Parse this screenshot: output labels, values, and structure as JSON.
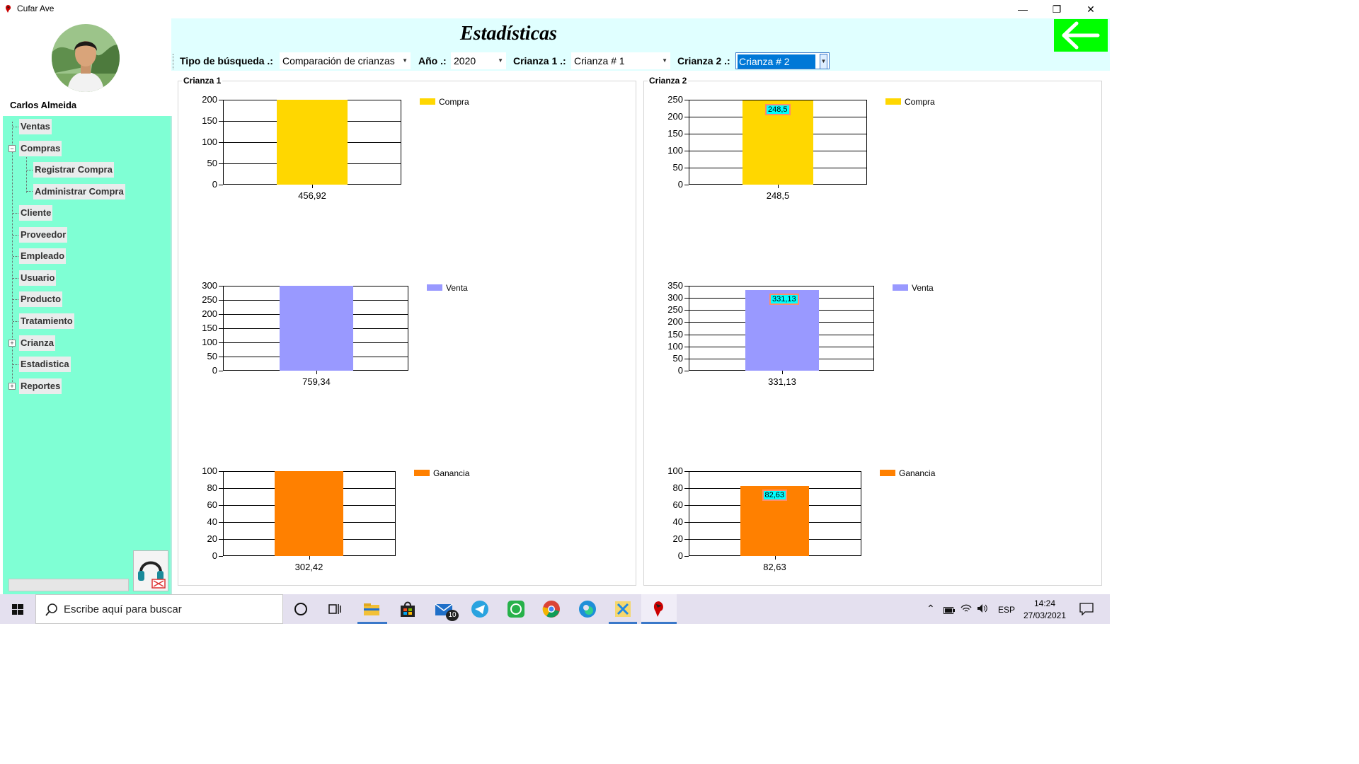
{
  "window": {
    "title": "Cufar Ave",
    "minimize_glyph": "—",
    "restore_glyph": "❐",
    "close_glyph": "✕"
  },
  "user": {
    "name": "Carlos Almeida"
  },
  "menu": {
    "items": [
      {
        "label": "Ventas"
      },
      {
        "label": "Compras",
        "expander": "−"
      },
      {
        "label": "Registrar Compra"
      },
      {
        "label": "Administrar Compra"
      },
      {
        "label": "Cliente"
      },
      {
        "label": "Proveedor"
      },
      {
        "label": "Empleado"
      },
      {
        "label": "Usuario"
      },
      {
        "label": "Producto"
      },
      {
        "label": "Tratamiento"
      },
      {
        "label": "Crianza",
        "expander": "+"
      },
      {
        "label": "Estadistica"
      },
      {
        "label": "Reportes",
        "expander": "+"
      }
    ]
  },
  "header": {
    "title": "Estadísticas",
    "back_icon": "arrow-left-icon",
    "filters": {
      "tipo_label": "Tipo de búsqueda .:",
      "tipo_value": "Comparación de crianzas",
      "anio_label": "Año .:",
      "anio_value": "2020",
      "crianza1_label": "Crianza 1 .:",
      "crianza1_value": "Crianza # 1",
      "crianza2_label": "Crianza 2 .:",
      "crianza2_value": "Crianza # 2"
    }
  },
  "groups": {
    "left_title": "Crianza 1",
    "right_title": "Crianza 2"
  },
  "colors": {
    "compra": "#ffd700",
    "venta": "#9999ff",
    "ganancia": "#ff8000",
    "menu_bg": "#7fffd4",
    "header_bg": "#e0ffff",
    "back_btn": "#00ff00"
  },
  "chart_data": [
    {
      "type": "bar",
      "group": "Crianza 1",
      "series": [
        {
          "name": "Compra",
          "values": [
            200
          ]
        }
      ],
      "categories": [
        "456,92"
      ],
      "ylim": [
        0,
        200
      ],
      "yticks": [
        "200",
        "150",
        "100",
        "50",
        "0"
      ],
      "legend": "top-right",
      "grid": true
    },
    {
      "type": "bar",
      "group": "Crianza 1",
      "series": [
        {
          "name": "Venta",
          "values": [
            300
          ]
        }
      ],
      "categories": [
        "759,34"
      ],
      "ylim": [
        0,
        300
      ],
      "yticks": [
        "300",
        "250",
        "200",
        "150",
        "100",
        "50",
        "0"
      ],
      "legend": "top-right",
      "grid": true
    },
    {
      "type": "bar",
      "group": "Crianza 1",
      "series": [
        {
          "name": "Ganancia",
          "values": [
            100
          ]
        }
      ],
      "categories": [
        "302,42"
      ],
      "ylim": [
        0,
        100
      ],
      "yticks": [
        "100",
        "80",
        "60",
        "40",
        "20",
        "0"
      ],
      "legend": "top-right",
      "grid": true
    },
    {
      "type": "bar",
      "group": "Crianza 2",
      "series": [
        {
          "name": "Compra",
          "values": [
            248.5
          ]
        }
      ],
      "categories": [
        "248,5"
      ],
      "data_label": "248,5",
      "ylim": [
        0,
        250
      ],
      "yticks": [
        "250",
        "200",
        "150",
        "100",
        "50",
        "0"
      ],
      "legend": "top-right",
      "grid": true
    },
    {
      "type": "bar",
      "group": "Crianza 2",
      "series": [
        {
          "name": "Venta",
          "values": [
            331.13
          ]
        }
      ],
      "categories": [
        "331,13"
      ],
      "data_label": "331,13",
      "ylim": [
        0,
        350
      ],
      "yticks": [
        "350",
        "300",
        "250",
        "200",
        "150",
        "100",
        "50",
        "0"
      ],
      "legend": "top-right",
      "grid": true
    },
    {
      "type": "bar",
      "group": "Crianza 2",
      "series": [
        {
          "name": "Ganancia",
          "values": [
            82.63
          ]
        }
      ],
      "categories": [
        "82,63"
      ],
      "data_label": "82,63",
      "ylim": [
        0,
        100
      ],
      "yticks": [
        "100",
        "80",
        "60",
        "40",
        "20",
        "0"
      ],
      "legend": "top-right",
      "grid": true
    }
  ],
  "taskbar": {
    "search_placeholder": "Escribe aquí para buscar",
    "mail_badge": "10",
    "language": "ESP",
    "time": "14:24",
    "date": "27/03/2021",
    "apps": [
      "cortana-icon",
      "task-view-icon",
      "file-explorer-icon",
      "store-icon",
      "mail-icon",
      "telegram-icon",
      "whatsapp-icon",
      "chrome-icon",
      "edge-icon",
      "app-icon",
      "cufar-ave-icon"
    ]
  }
}
